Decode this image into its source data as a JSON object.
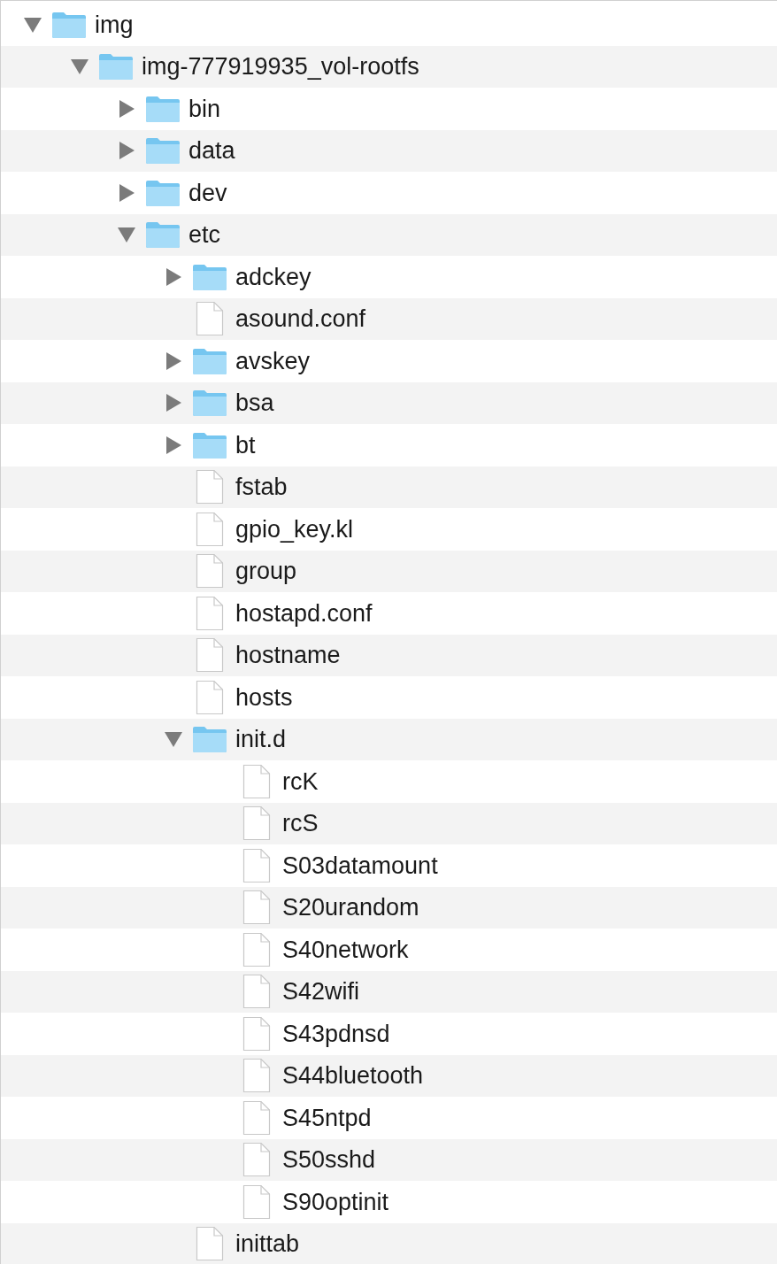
{
  "tree": [
    {
      "kind": "folder",
      "name": "img",
      "expanded": true,
      "children": [
        {
          "kind": "folder",
          "name": "img-777919935_vol-rootfs",
          "expanded": true,
          "children": [
            {
              "kind": "folder",
              "name": "bin",
              "expanded": false
            },
            {
              "kind": "folder",
              "name": "data",
              "expanded": false
            },
            {
              "kind": "folder",
              "name": "dev",
              "expanded": false
            },
            {
              "kind": "folder",
              "name": "etc",
              "expanded": true,
              "children": [
                {
                  "kind": "folder",
                  "name": "adckey",
                  "expanded": false
                },
                {
                  "kind": "file",
                  "name": "asound.conf"
                },
                {
                  "kind": "folder",
                  "name": "avskey",
                  "expanded": false
                },
                {
                  "kind": "folder",
                  "name": "bsa",
                  "expanded": false
                },
                {
                  "kind": "folder",
                  "name": "bt",
                  "expanded": false
                },
                {
                  "kind": "file",
                  "name": "fstab"
                },
                {
                  "kind": "file",
                  "name": "gpio_key.kl"
                },
                {
                  "kind": "file",
                  "name": "group"
                },
                {
                  "kind": "file",
                  "name": "hostapd.conf"
                },
                {
                  "kind": "file",
                  "name": "hostname"
                },
                {
                  "kind": "file",
                  "name": "hosts"
                },
                {
                  "kind": "folder",
                  "name": "init.d",
                  "expanded": true,
                  "children": [
                    {
                      "kind": "file",
                      "name": "rcK"
                    },
                    {
                      "kind": "file",
                      "name": "rcS"
                    },
                    {
                      "kind": "file",
                      "name": "S03datamount"
                    },
                    {
                      "kind": "file",
                      "name": "S20urandom"
                    },
                    {
                      "kind": "file",
                      "name": "S40network"
                    },
                    {
                      "kind": "file",
                      "name": "S42wifi"
                    },
                    {
                      "kind": "file",
                      "name": "S43pdnsd"
                    },
                    {
                      "kind": "file",
                      "name": "S44bluetooth"
                    },
                    {
                      "kind": "file",
                      "name": "S45ntpd"
                    },
                    {
                      "kind": "file",
                      "name": "S50sshd"
                    },
                    {
                      "kind": "file",
                      "name": "S90optinit"
                    }
                  ]
                },
                {
                  "kind": "file",
                  "name": "inittab"
                }
              ]
            }
          ]
        }
      ]
    }
  ]
}
